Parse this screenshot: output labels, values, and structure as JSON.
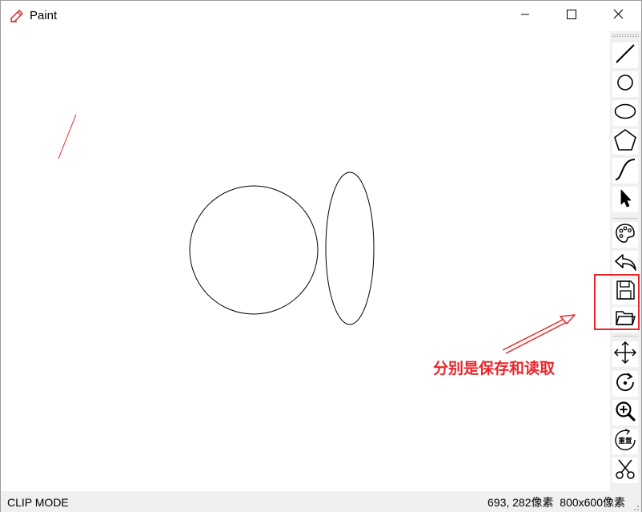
{
  "window": {
    "title": "Paint",
    "icons": {
      "app": "pencil-icon",
      "minimize": "minimize-icon",
      "maximize": "maximize-icon",
      "close": "close-icon"
    }
  },
  "canvas": {
    "shapes": [
      "red line",
      "circle",
      "ellipse"
    ],
    "colors": {
      "line": "#e0282c",
      "outline": "#000000"
    }
  },
  "toolbar": {
    "tools": [
      {
        "name": "line-tool",
        "icon": "line-icon"
      },
      {
        "name": "circle-tool",
        "icon": "circle-icon"
      },
      {
        "name": "ellipse-tool",
        "icon": "ellipse-icon"
      },
      {
        "name": "polygon-tool",
        "icon": "pentagon-icon"
      },
      {
        "name": "curve-tool",
        "icon": "curve-icon"
      },
      {
        "name": "select-tool",
        "icon": "cursor-icon"
      },
      {
        "name": "color-tool",
        "icon": "palette-icon"
      },
      {
        "name": "undo-tool",
        "icon": "undo-icon"
      },
      {
        "name": "save-tool",
        "icon": "save-icon"
      },
      {
        "name": "open-tool",
        "icon": "folder-icon"
      },
      {
        "name": "move-tool",
        "icon": "move-icon"
      },
      {
        "name": "rotate-tool",
        "icon": "rotate-icon"
      },
      {
        "name": "zoom-tool",
        "icon": "zoom-in-icon"
      },
      {
        "name": "reset-tool",
        "icon": "reset-icon",
        "label": "重置"
      },
      {
        "name": "clip-tool",
        "icon": "scissors-icon"
      }
    ]
  },
  "statusbar": {
    "mode": "CLIP MODE",
    "coords": "693, 282像素",
    "canvas_size": "800x600像素"
  },
  "annotation": {
    "text": "分别是保存和读取",
    "color": "#e8262b"
  }
}
